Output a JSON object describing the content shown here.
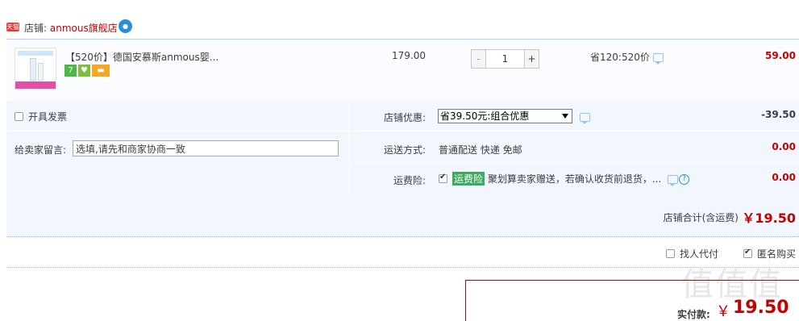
{
  "shop": {
    "badge": "天猫",
    "label": "店铺: ",
    "name": "anmous旗舰店",
    "ww_icon": "wangwang-chat-icon"
  },
  "item": {
    "title": "【520价】德国安慕斯anmous婴...",
    "unit_price": "179.00",
    "quantity": "1",
    "minus": "-",
    "plus": "+",
    "promo": "省120:520价",
    "subtotal": "59.00",
    "tags": [
      "7",
      "♥",
      "▬"
    ]
  },
  "options": {
    "invoice_label": "开具发票",
    "message_label": "给卖家留言:",
    "message_placeholder": "选填,请先和商家协商一致",
    "discount_label": "店铺优惠:",
    "discount_selected": "省39.50元:组合优惠",
    "discount_amount": "-39.50",
    "shipping_label": "运送方式:",
    "shipping_value": "普通配送 快递 免邮",
    "shipping_amount": "0.00",
    "insurance_label": "运费险:",
    "insurance_badge": "运费险",
    "insurance_text": "聚划算卖家赠送，若确认收货前退货，...",
    "insurance_amount": "0.00",
    "help": "?"
  },
  "shop_total": {
    "label": "店铺合计(含运费)",
    "amount": "￥19.50"
  },
  "proxy": {
    "find_proxy": "找人代付",
    "anonymous": "匿名购买"
  },
  "payment": {
    "label": "实付款:",
    "yen": "￥",
    "amount": "19.50"
  },
  "watermark": "值值值",
  "colors": {
    "accent_red": "#c40000",
    "light_blue_bg": "#f2f7ff",
    "border_blue": "#b2d1ff"
  }
}
